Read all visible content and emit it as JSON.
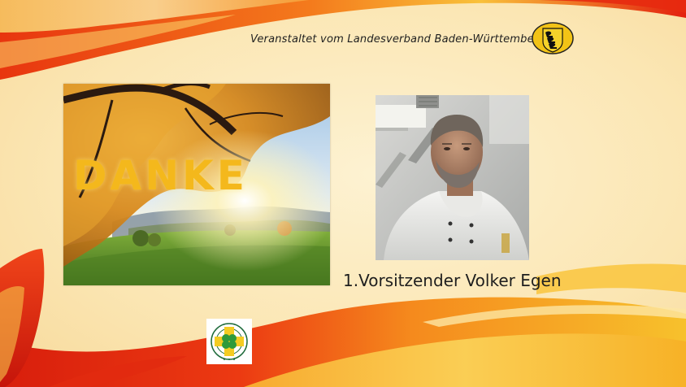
{
  "slide": {
    "header": "Veranstaltet vom Landesverband Baden-Württemberg",
    "danke_word": "DANKE",
    "caption": "1.Vorsitzender Volker Egen"
  },
  "logos": {
    "state": "baden-wuerttemberg-coat-of-arms-icon",
    "association": "verband-der-koeche-deutschlands-logo"
  },
  "colors": {
    "background": "#fbe8b8",
    "swoosh_red": "#e02a10",
    "swoosh_orange": "#f68a1a",
    "swoosh_yellow": "#f7c531",
    "danke_text": "#f4b81c"
  }
}
